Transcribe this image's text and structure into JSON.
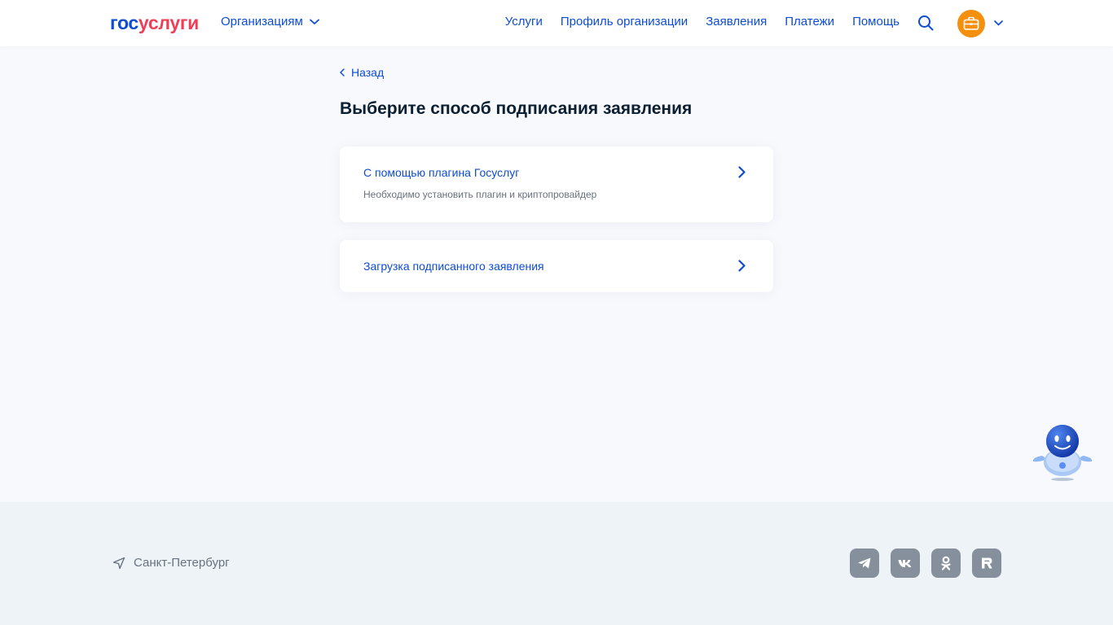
{
  "header": {
    "logo_part1": "гос",
    "logo_part2": "услуги",
    "org_menu_label": "Организациям",
    "nav": [
      {
        "label": "Услуги"
      },
      {
        "label": "Профиль организации"
      },
      {
        "label": "Заявления"
      },
      {
        "label": "Платежи"
      },
      {
        "label": "Помощь"
      }
    ],
    "search_icon": "search-icon",
    "avatar_icon": "briefcase-icon"
  },
  "main": {
    "back_label": "Назад",
    "title": "Выберите способ подписания заявления",
    "options": [
      {
        "title": "С помощью плагина Госуслуг",
        "subtitle": "Необходимо установить плагин и криптопровайдер"
      },
      {
        "title": "Загрузка подписанного заявления"
      }
    ]
  },
  "footer": {
    "location": "Санкт-Петербург",
    "socials": [
      "telegram-icon",
      "vk-icon",
      "odnoklassniki-icon",
      "rutube-icon"
    ]
  },
  "colors": {
    "accent": "#0d4cd3",
    "logo_red": "#ee3f58",
    "avatar": "#f5900f",
    "page_bg": "#f7f9fd",
    "footer_bg": "#eef3f7",
    "social_bg": "#86909c"
  }
}
